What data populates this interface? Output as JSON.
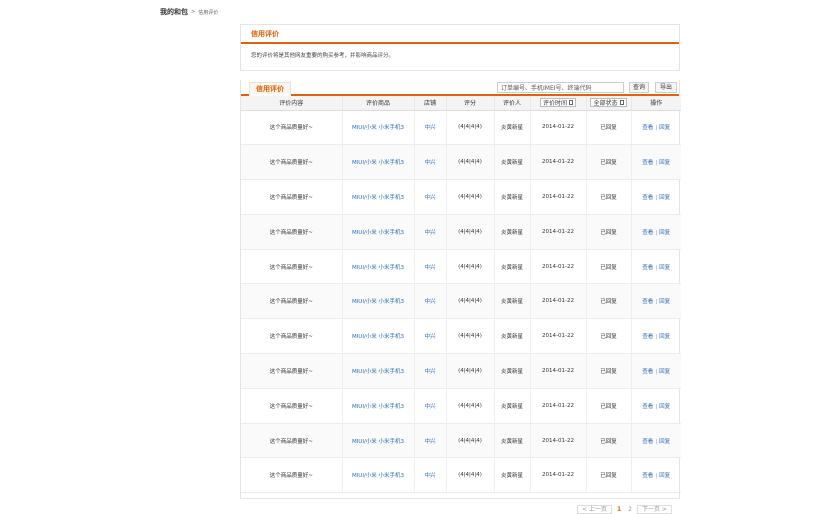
{
  "breadcrumb": {
    "root": "我的和包",
    "separator": ">",
    "current": "信用评价"
  },
  "intro_panel": {
    "title": "信用评价",
    "notice": "您的评价将是其他网友重要的购买参考，并影响商品评分。"
  },
  "list": {
    "tab_label": "信用评价",
    "search": {
      "value": "订单编号、手机IMEI号、终端代码"
    },
    "query_button": "查询",
    "export_button": "导出",
    "columns": [
      "评价内容",
      "评价商品",
      "店铺",
      "评分",
      "评价人",
      "评价时间",
      "全部状态",
      "操作"
    ],
    "filters": {
      "time": "评价时间",
      "status": "全部状态"
    },
    "rows": [
      {
        "content": "这个商品质量好~",
        "product": "MIUI/小米 小米手机3",
        "shop": "中兴",
        "score": "(4|4|4|4)",
        "reviewer": "炎黄新星",
        "date": "2014-01-22",
        "status": "已回复",
        "view": "查看",
        "reply": "回复"
      },
      {
        "content": "这个商品质量好~",
        "product": "MIUI/小米 小米手机3",
        "shop": "中兴",
        "score": "(4|4|4|4)",
        "reviewer": "炎黄新星",
        "date": "2014-01-22",
        "status": "已回复",
        "view": "查看",
        "reply": "回复"
      },
      {
        "content": "这个商品质量好~",
        "product": "MIUI/小米 小米手机3",
        "shop": "中兴",
        "score": "(4|4|4|4)",
        "reviewer": "炎黄新星",
        "date": "2014-01-22",
        "status": "已回复",
        "view": "查看",
        "reply": "回复"
      },
      {
        "content": "这个商品质量好~",
        "product": "MIUI/小米 小米手机3",
        "shop": "中兴",
        "score": "(4|4|4|4)",
        "reviewer": "炎黄新星",
        "date": "2014-01-22",
        "status": "已回复",
        "view": "查看",
        "reply": "回复"
      },
      {
        "content": "这个商品质量好~",
        "product": "MIUI/小米 小米手机3",
        "shop": "中兴",
        "score": "(4|4|4|4)",
        "reviewer": "炎黄新星",
        "date": "2014-01-22",
        "status": "已回复",
        "view": "查看",
        "reply": "回复"
      },
      {
        "content": "这个商品质量好~",
        "product": "MIUI/小米 小米手机3",
        "shop": "中兴",
        "score": "(4|4|4|4)",
        "reviewer": "炎黄新星",
        "date": "2014-01-22",
        "status": "已回复",
        "view": "查看",
        "reply": "回复"
      },
      {
        "content": "这个商品质量好~",
        "product": "MIUI/小米 小米手机3",
        "shop": "中兴",
        "score": "(4|4|4|4)",
        "reviewer": "炎黄新星",
        "date": "2014-01-22",
        "status": "已回复",
        "view": "查看",
        "reply": "回复"
      },
      {
        "content": "这个商品质量好~",
        "product": "MIUI/小米 小米手机3",
        "shop": "中兴",
        "score": "(4|4|4|4)",
        "reviewer": "炎黄新星",
        "date": "2014-01-22",
        "status": "已回复",
        "view": "查看",
        "reply": "回复"
      },
      {
        "content": "这个商品质量好~",
        "product": "MIUI/小米 小米手机3",
        "shop": "中兴",
        "score": "(4|4|4|4)",
        "reviewer": "炎黄新星",
        "date": "2014-01-22",
        "status": "已回复",
        "view": "查看",
        "reply": "回复"
      },
      {
        "content": "这个商品质量好~",
        "product": "MIUI/小米 小米手机3",
        "shop": "中兴",
        "score": "(4|4|4|4)",
        "reviewer": "炎黄新星",
        "date": "2014-01-22",
        "status": "已回复",
        "view": "查看",
        "reply": "回复"
      },
      {
        "content": "这个商品质量好~",
        "product": "MIUI/小米 小米手机3",
        "shop": "中兴",
        "score": "(4|4|4|4)",
        "reviewer": "炎黄新星",
        "date": "2014-01-22",
        "status": "已回复",
        "view": "查看",
        "reply": "回复"
      }
    ]
  },
  "pagination": {
    "prev": "< 上一页",
    "pages": [
      "1",
      "2"
    ],
    "current": "1",
    "next": "下一页 >"
  },
  "colors": {
    "accent": "#e4600a",
    "link": "#2a6bb8"
  }
}
